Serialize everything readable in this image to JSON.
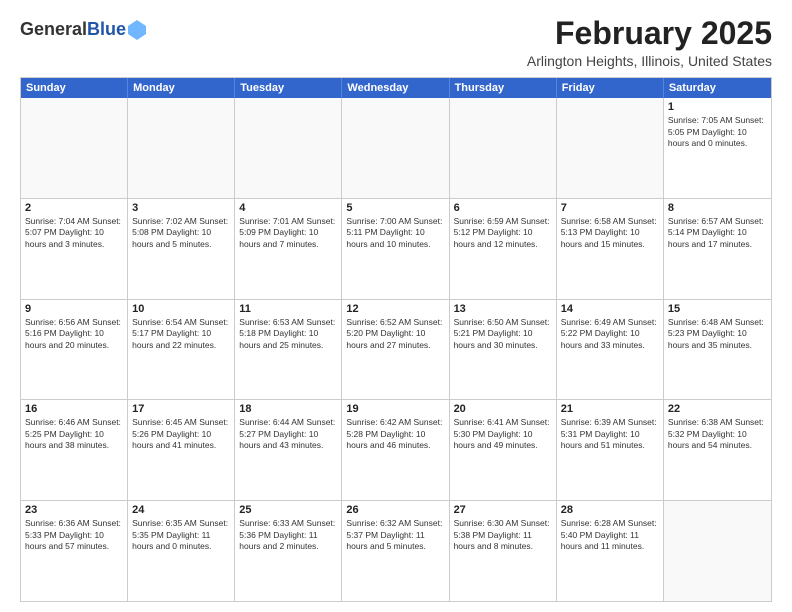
{
  "header": {
    "logo_general": "General",
    "logo_blue": "Blue",
    "month_title": "February 2025",
    "location": "Arlington Heights, Illinois, United States"
  },
  "days_of_week": [
    "Sunday",
    "Monday",
    "Tuesday",
    "Wednesday",
    "Thursday",
    "Friday",
    "Saturday"
  ],
  "weeks": [
    [
      {
        "day": "",
        "info": ""
      },
      {
        "day": "",
        "info": ""
      },
      {
        "day": "",
        "info": ""
      },
      {
        "day": "",
        "info": ""
      },
      {
        "day": "",
        "info": ""
      },
      {
        "day": "",
        "info": ""
      },
      {
        "day": "1",
        "info": "Sunrise: 7:05 AM\nSunset: 5:05 PM\nDaylight: 10 hours\nand 0 minutes."
      }
    ],
    [
      {
        "day": "2",
        "info": "Sunrise: 7:04 AM\nSunset: 5:07 PM\nDaylight: 10 hours\nand 3 minutes."
      },
      {
        "day": "3",
        "info": "Sunrise: 7:02 AM\nSunset: 5:08 PM\nDaylight: 10 hours\nand 5 minutes."
      },
      {
        "day": "4",
        "info": "Sunrise: 7:01 AM\nSunset: 5:09 PM\nDaylight: 10 hours\nand 7 minutes."
      },
      {
        "day": "5",
        "info": "Sunrise: 7:00 AM\nSunset: 5:11 PM\nDaylight: 10 hours\nand 10 minutes."
      },
      {
        "day": "6",
        "info": "Sunrise: 6:59 AM\nSunset: 5:12 PM\nDaylight: 10 hours\nand 12 minutes."
      },
      {
        "day": "7",
        "info": "Sunrise: 6:58 AM\nSunset: 5:13 PM\nDaylight: 10 hours\nand 15 minutes."
      },
      {
        "day": "8",
        "info": "Sunrise: 6:57 AM\nSunset: 5:14 PM\nDaylight: 10 hours\nand 17 minutes."
      }
    ],
    [
      {
        "day": "9",
        "info": "Sunrise: 6:56 AM\nSunset: 5:16 PM\nDaylight: 10 hours\nand 20 minutes."
      },
      {
        "day": "10",
        "info": "Sunrise: 6:54 AM\nSunset: 5:17 PM\nDaylight: 10 hours\nand 22 minutes."
      },
      {
        "day": "11",
        "info": "Sunrise: 6:53 AM\nSunset: 5:18 PM\nDaylight: 10 hours\nand 25 minutes."
      },
      {
        "day": "12",
        "info": "Sunrise: 6:52 AM\nSunset: 5:20 PM\nDaylight: 10 hours\nand 27 minutes."
      },
      {
        "day": "13",
        "info": "Sunrise: 6:50 AM\nSunset: 5:21 PM\nDaylight: 10 hours\nand 30 minutes."
      },
      {
        "day": "14",
        "info": "Sunrise: 6:49 AM\nSunset: 5:22 PM\nDaylight: 10 hours\nand 33 minutes."
      },
      {
        "day": "15",
        "info": "Sunrise: 6:48 AM\nSunset: 5:23 PM\nDaylight: 10 hours\nand 35 minutes."
      }
    ],
    [
      {
        "day": "16",
        "info": "Sunrise: 6:46 AM\nSunset: 5:25 PM\nDaylight: 10 hours\nand 38 minutes."
      },
      {
        "day": "17",
        "info": "Sunrise: 6:45 AM\nSunset: 5:26 PM\nDaylight: 10 hours\nand 41 minutes."
      },
      {
        "day": "18",
        "info": "Sunrise: 6:44 AM\nSunset: 5:27 PM\nDaylight: 10 hours\nand 43 minutes."
      },
      {
        "day": "19",
        "info": "Sunrise: 6:42 AM\nSunset: 5:28 PM\nDaylight: 10 hours\nand 46 minutes."
      },
      {
        "day": "20",
        "info": "Sunrise: 6:41 AM\nSunset: 5:30 PM\nDaylight: 10 hours\nand 49 minutes."
      },
      {
        "day": "21",
        "info": "Sunrise: 6:39 AM\nSunset: 5:31 PM\nDaylight: 10 hours\nand 51 minutes."
      },
      {
        "day": "22",
        "info": "Sunrise: 6:38 AM\nSunset: 5:32 PM\nDaylight: 10 hours\nand 54 minutes."
      }
    ],
    [
      {
        "day": "23",
        "info": "Sunrise: 6:36 AM\nSunset: 5:33 PM\nDaylight: 10 hours\nand 57 minutes."
      },
      {
        "day": "24",
        "info": "Sunrise: 6:35 AM\nSunset: 5:35 PM\nDaylight: 11 hours\nand 0 minutes."
      },
      {
        "day": "25",
        "info": "Sunrise: 6:33 AM\nSunset: 5:36 PM\nDaylight: 11 hours\nand 2 minutes."
      },
      {
        "day": "26",
        "info": "Sunrise: 6:32 AM\nSunset: 5:37 PM\nDaylight: 11 hours\nand 5 minutes."
      },
      {
        "day": "27",
        "info": "Sunrise: 6:30 AM\nSunset: 5:38 PM\nDaylight: 11 hours\nand 8 minutes."
      },
      {
        "day": "28",
        "info": "Sunrise: 6:28 AM\nSunset: 5:40 PM\nDaylight: 11 hours\nand 11 minutes."
      },
      {
        "day": "",
        "info": ""
      }
    ]
  ]
}
